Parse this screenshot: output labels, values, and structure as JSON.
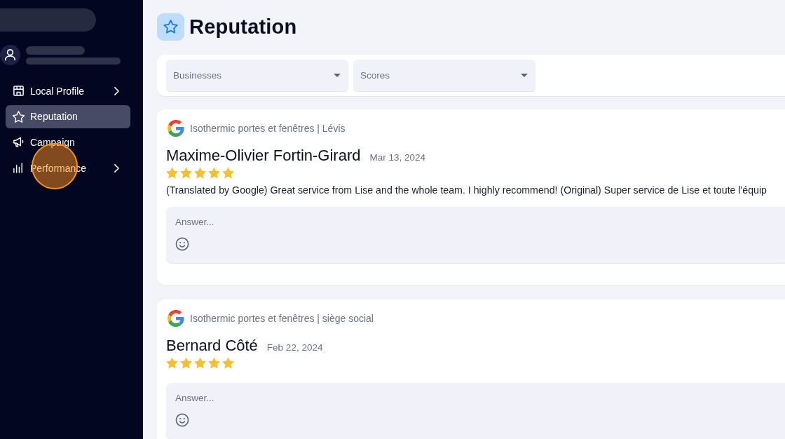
{
  "sidebar": {
    "nav_items": [
      {
        "label": "Local Profile",
        "selected": false,
        "expandable": true,
        "clicked": false
      },
      {
        "label": "Reputation",
        "selected": true,
        "expandable": false,
        "clicked": false
      },
      {
        "label": "Campaign",
        "selected": false,
        "expandable": false,
        "clicked": false
      },
      {
        "label": "Performance",
        "selected": false,
        "expandable": true,
        "clicked": true
      }
    ]
  },
  "page": {
    "title": "Reputation"
  },
  "filters": [
    {
      "placeholder": "Businesses"
    },
    {
      "placeholder": "Scores"
    }
  ],
  "reviews": [
    {
      "source": "Isothermic portes et fenêtres | Lévis",
      "author": "Maxime-Olivier Fortin-Girard",
      "date": "Mar 13, 2024",
      "stars": 5,
      "text": "(Translated by Google) Great service from Lise and the whole team. I highly recommend! (Original) Super service de Lise et toute l'équip",
      "answer": {
        "placeholder": "Answer..."
      }
    },
    {
      "source": "Isothermic portes et fenêtres | siège social",
      "author": "Bernard Côté",
      "date": "Feb 22, 2024",
      "stars": 5,
      "answer": {
        "placeholder": "Answer..."
      }
    }
  ]
}
